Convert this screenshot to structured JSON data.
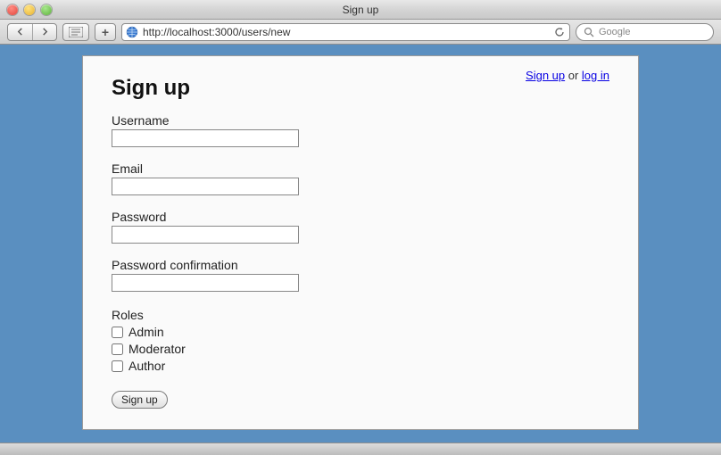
{
  "window": {
    "title": "Sign up"
  },
  "toolbar": {
    "url": "http://localhost:3000/users/new",
    "search_placeholder": "Google"
  },
  "auth": {
    "signup": "Sign up",
    "sep": " or ",
    "login": "log in"
  },
  "page": {
    "heading": "Sign up",
    "username_label": "Username",
    "email_label": "Email",
    "password_label": "Password",
    "password_confirmation_label": "Password confirmation",
    "roles_label": "Roles",
    "roles": [
      {
        "label": "Admin"
      },
      {
        "label": "Moderator"
      },
      {
        "label": "Author"
      }
    ],
    "submit_label": "Sign up"
  }
}
